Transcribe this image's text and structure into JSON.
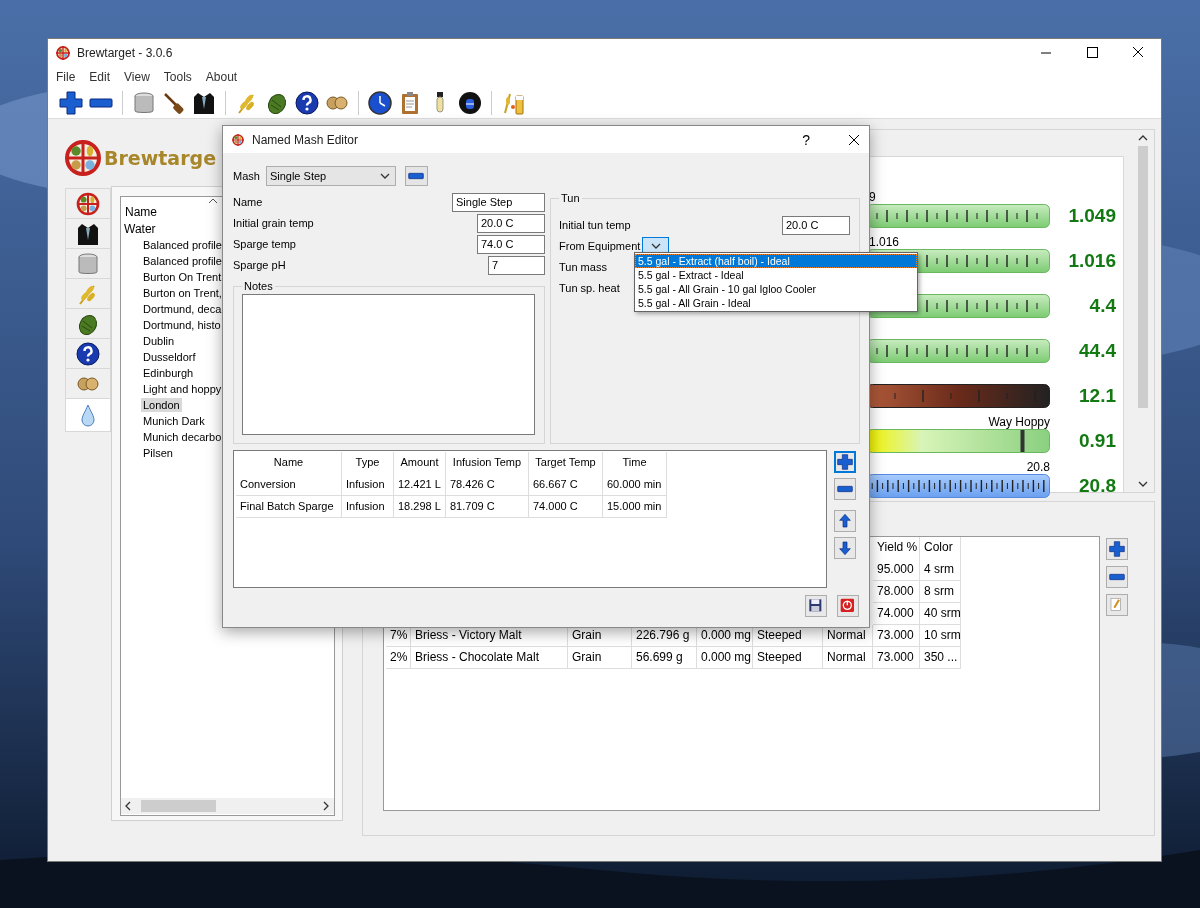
{
  "window": {
    "title": "Brewtarget - 3.0.6"
  },
  "menu": [
    "File",
    "Edit",
    "View",
    "Tools",
    "About"
  ],
  "logo": {
    "text": "Brewtarge"
  },
  "side_tabs": [
    {
      "selected": false
    },
    {
      "selected": false
    },
    {
      "selected": false
    },
    {
      "selected": false
    },
    {
      "selected": false
    },
    {
      "selected": false
    },
    {
      "selected": false
    },
    {
      "selected": true
    }
  ],
  "tree": {
    "header": "Name",
    "root": {
      "label": "Water",
      "children": [
        {
          "label": "Balanced profile",
          "selected": false
        },
        {
          "label": "Balanced profile",
          "selected": false
        },
        {
          "label": "Burton On Trent",
          "selected": false
        },
        {
          "label": "Burton on Trent,",
          "selected": false
        },
        {
          "label": "Dortmund, deca",
          "selected": false
        },
        {
          "label": "Dortmund, histo",
          "selected": false
        },
        {
          "label": "Dublin",
          "selected": false
        },
        {
          "label": "Dusseldorf",
          "selected": false
        },
        {
          "label": "Edinburgh",
          "selected": false
        },
        {
          "label": "Light and hoppy",
          "selected": false
        },
        {
          "label": "London",
          "selected": true
        },
        {
          "label": "Munich Dark",
          "selected": false
        },
        {
          "label": "Munich decarbo",
          "selected": false
        },
        {
          "label": "Pilsen",
          "selected": false
        }
      ]
    }
  },
  "gauges": [
    {
      "kind": "green",
      "label": "9",
      "value": "1.049"
    },
    {
      "kind": "green",
      "label": "1.016",
      "value": "1.016"
    },
    {
      "kind": "green",
      "value": "4.4"
    },
    {
      "kind": "green",
      "value": "44.4"
    },
    {
      "kind": "brown",
      "value": "12.1"
    },
    {
      "kind": "ratio",
      "label": "Way Hoppy",
      "level": 0.85,
      "value": "0.91"
    },
    {
      "kind": "blue",
      "label": "20.8",
      "value": "20.8"
    }
  ],
  "ingredients": {
    "columns": [
      "Yield %",
      "Color"
    ],
    "rows": [
      {
        "cells": [
          "95.000",
          "4 srm"
        ]
      },
      {
        "cells": [
          "78.000",
          "8 srm"
        ]
      },
      {
        "cells": [
          "74.000",
          "40 srm"
        ]
      },
      {
        "cells": [
          "7%",
          "Briess - Victory Malt",
          "Grain",
          "226.796 g",
          "0.000 mg",
          "Steeped",
          "Normal",
          "73.000",
          "10 srm"
        ]
      },
      {
        "cells": [
          "2%",
          "Briess - Chocolate Malt",
          "Grain",
          "56.699 g",
          "0.000 mg",
          "Steeped",
          "Normal",
          "73.000",
          "350 ..."
        ]
      }
    ]
  },
  "dialog": {
    "title": "Named Mash Editor",
    "help": "?",
    "mash_label": "Mash",
    "mash_value": "Single Step",
    "fields": [
      {
        "label": "Name",
        "value": "Single Step"
      },
      {
        "label": "Initial grain temp",
        "value": "20.0 C"
      },
      {
        "label": "Sparge temp",
        "value": "74.0 C"
      },
      {
        "label": "Sparge pH",
        "value": "7"
      }
    ],
    "notes_label": "Notes",
    "tun": {
      "title": "Tun",
      "rows": [
        {
          "kind": "field",
          "label": "Initial tun temp",
          "value": "20.0 C"
        },
        {
          "kind": "combo",
          "label": "From Equipment"
        },
        {
          "kind": "plain",
          "label": "Tun mass"
        },
        {
          "kind": "plain",
          "label": "Tun sp. heat"
        }
      ]
    },
    "steps": {
      "columns": [
        "Name",
        "Type",
        "Amount",
        "Infusion Temp",
        "Target Temp",
        "Time"
      ],
      "rows": [
        [
          "Conversion",
          "Infusion",
          "12.421 L",
          "78.426 C",
          "66.667 C",
          "60.000 min"
        ],
        [
          "Final Batch Sparge",
          "Infusion",
          "18.298 L",
          "81.709 C",
          "74.000 C",
          "15.000 min"
        ]
      ]
    },
    "dropdown": [
      {
        "label": "5.5 gal - Extract (half boil) - Ideal",
        "selected": true
      },
      {
        "label": "5.5 gal - Extract - Ideal",
        "selected": false
      },
      {
        "label": "5.5 gal - All Grain - 10 gal Igloo Cooler",
        "selected": false
      },
      {
        "label": "5.5 gal - All Grain - Ideal",
        "selected": false
      }
    ]
  }
}
